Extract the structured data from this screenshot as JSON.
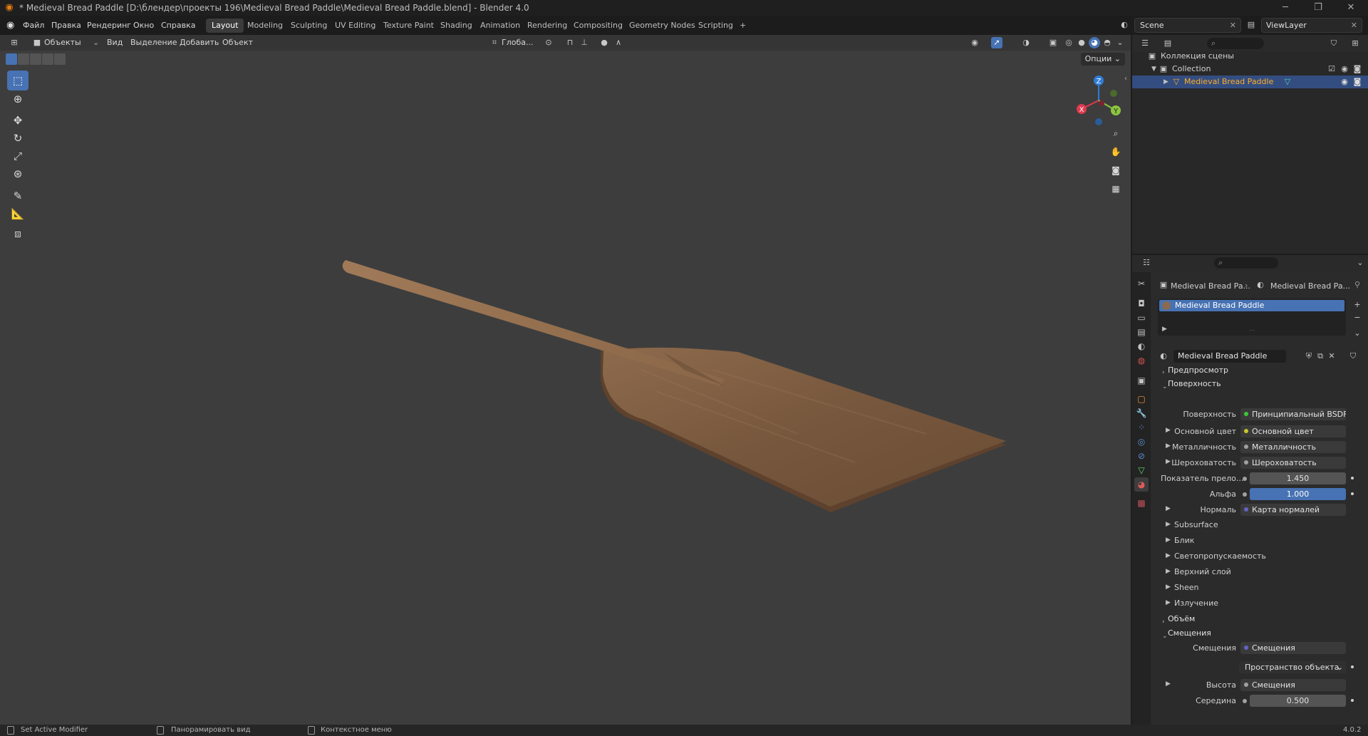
{
  "window": {
    "title": "* Medieval Bread Paddle [D:\\блендер\\проекты 196\\Medieval Bread Paddle\\Medieval Bread Paddle.blend] - Blender 4.0"
  },
  "menu": {
    "items": [
      "Файл",
      "Правка",
      "Рендеринг",
      "Окно",
      "Справка"
    ]
  },
  "workspaces": [
    {
      "label": "Layout",
      "active": true
    },
    {
      "label": "Modeling"
    },
    {
      "label": "Sculpting"
    },
    {
      "label": "UV Editing"
    },
    {
      "label": "Texture Paint"
    },
    {
      "label": "Shading"
    },
    {
      "label": "Animation"
    },
    {
      "label": "Rendering"
    },
    {
      "label": "Compositing"
    },
    {
      "label": "Geometry Nodes"
    },
    {
      "label": "Scripting"
    },
    {
      "label": "+"
    }
  ],
  "scene": {
    "name": "Scene",
    "view_layer": "ViewLayer"
  },
  "viewport": {
    "mode": "Объекты",
    "menus": [
      "Вид",
      "Выделение",
      "Добавить",
      "Объект"
    ],
    "orientation": "Глоба...",
    "options_label": "Опции",
    "gizmo_labels": {
      "x": "X",
      "y": "Y",
      "z": "Z"
    }
  },
  "outliner": {
    "scene_collection": "Коллекция сцены",
    "collection": "Collection",
    "object": "Medieval Bread Paddle"
  },
  "properties": {
    "breadcrumb_object": "Medieval Bread Pa...",
    "breadcrumb_material": "Medieval Bread Pa...",
    "slot_name": "Medieval Bread Paddle",
    "material_name": "Medieval Bread Paddle",
    "panels": {
      "preview": "Предпросмотр",
      "surface": "Поверхность",
      "volume": "Объём",
      "displacement": "Смещения"
    },
    "surface_rows": [
      {
        "label": "Поверхность",
        "value": "Принципиальный BSDF",
        "dot": "#39c939"
      },
      {
        "label": "Основной цвет",
        "value": "Основной цвет",
        "dot": "#c7c729",
        "expand": true
      },
      {
        "label": "Металличность",
        "value": "Металличность",
        "dot": "#a1a1a1",
        "expand": true
      },
      {
        "label": "Шероховатость",
        "value": "Шероховатость",
        "dot": "#a1a1a1",
        "expand": true
      },
      {
        "label": "Показатель прело...",
        "value": "1.450",
        "dot": "#a1a1a1",
        "num": true
      },
      {
        "label": "Альфа",
        "value": "1.000",
        "dot": "#a1a1a1",
        "num": true,
        "highlight": true
      },
      {
        "label": "Нормаль",
        "value": "Карта нормалей",
        "dot": "#6363c7",
        "expand": true
      }
    ],
    "subpanels": [
      "Subsurface",
      "Блик",
      "Светопропускаемость",
      "Верхний слой",
      "Sheen",
      "Излучение"
    ],
    "displacement_rows": {
      "displacement_label": "Смещения",
      "displacement_value": "Смещения",
      "space_value": "Пространство объекта",
      "height_label": "Высота",
      "height_value": "Смещения",
      "midlevel_label": "Середина",
      "midlevel_value": "0.500"
    }
  },
  "status": {
    "left": "Set Active Modifier",
    "middle": "Панорамировать вид",
    "right": "Контекстное меню",
    "version": "4.0.2"
  }
}
